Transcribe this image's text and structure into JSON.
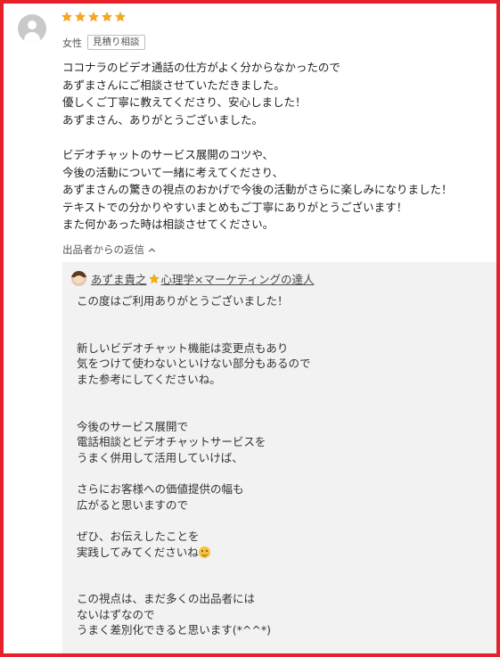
{
  "review": {
    "rating": 5,
    "star_color": "#f5a623",
    "gender": "女性",
    "badge": "見積り相談",
    "lines": [
      "ココナラのビデオ通話の仕方がよく分からなかったので",
      "あずまさんにご相談させていただきました。",
      "優しくご丁寧に教えてくださり、安心しました！",
      "あずまさん、ありがとうございました。",
      "",
      "ビデオチャットのサービス展開のコツや、",
      "今後の活動について一緒に考えてくださり、",
      "あずまさんの驚きの視点のおかげで今後の活動がさらに楽しみになりました！",
      "テキストでの分かりやすいまとめもご丁寧にありがとうございます！",
      "また何かあった時は相談させてください。"
    ]
  },
  "reply": {
    "toggle_label": "出品者からの返信",
    "seller_name_prefix": "あずま貴之",
    "seller_name_suffix": "心理学×マーケティングの達人",
    "border_color": "#e8202a",
    "lines": [
      "この度はご利用ありがとうございました！",
      "",
      "",
      "新しいビデオチャット機能は変更点もあり",
      "気をつけて使わないといけない部分もあるので",
      "また参考にしてくださいね。",
      "",
      "",
      "今後のサービス展開で",
      "電話相談とビデオチャットサービスを",
      "うまく併用して活用していけば、",
      "",
      "さらにお客様への価値提供の幅も",
      "広がると思いますので",
      "",
      "ぜひ、お伝えしたことを",
      "実践してみてくださいね",
      "",
      "",
      "この視点は、まだ多くの出品者には",
      "ないはずなので",
      "うまく差別化できると思います(*^^*)"
    ]
  }
}
